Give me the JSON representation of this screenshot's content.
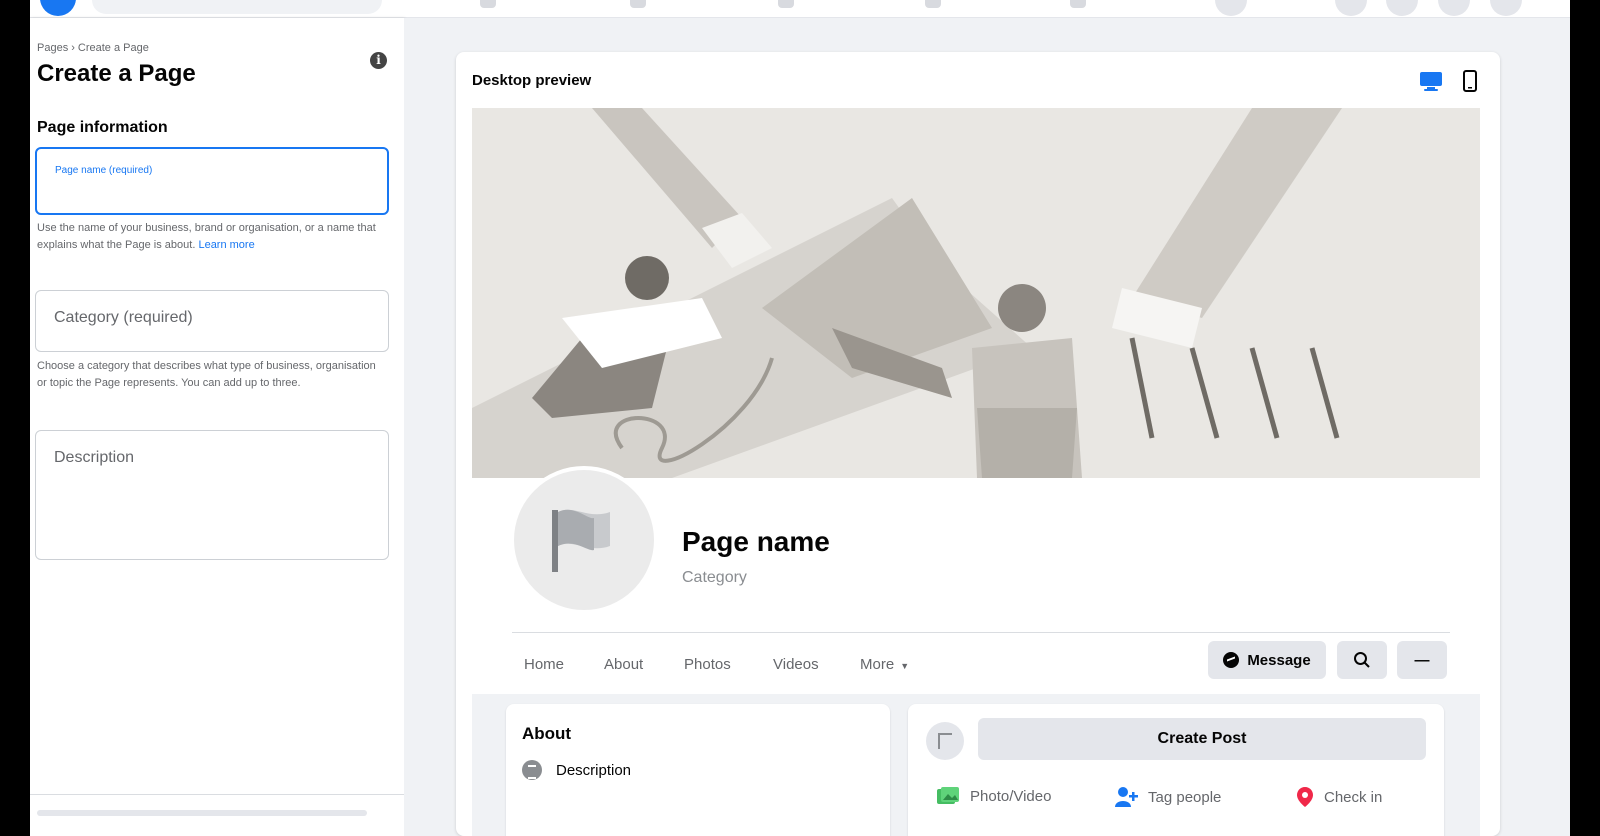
{
  "colors": {
    "accent": "#1877f2",
    "text": "#050505",
    "muted": "#65676b",
    "canvas": "#f0f2f5"
  },
  "breadcrumb": {
    "parent": "Pages",
    "separator": "›",
    "current": "Create a Page"
  },
  "panel": {
    "title": "Create a Page",
    "info_icon": "i",
    "section_title": "Page information",
    "page_name": {
      "label": "Page name (required)",
      "value": ""
    },
    "page_name_help": "Use the name of your business, brand or organisation, or a name that explains what the Page is about.",
    "learn_more": "Learn more",
    "category": {
      "label": "Category (required)",
      "value": ""
    },
    "category_help": "Choose a category that describes what type of business, organisation or topic the Page represents. You can add up to three.",
    "description": {
      "label": "Description",
      "value": ""
    }
  },
  "preview": {
    "title": "Desktop preview",
    "icons": {
      "desktop": "desktop-icon",
      "mobile": "mobile-phone-icon"
    },
    "page_name": "Page name",
    "category": "Category",
    "tabs": [
      "Home",
      "About",
      "Photos",
      "Videos",
      "More"
    ],
    "buttons": {
      "message": "Message",
      "more": "—"
    },
    "about": {
      "title": "About",
      "description": "Description"
    },
    "post": {
      "create": "Create Post",
      "actions": [
        "Photo/Video",
        "Tag people",
        "Check in"
      ]
    }
  }
}
